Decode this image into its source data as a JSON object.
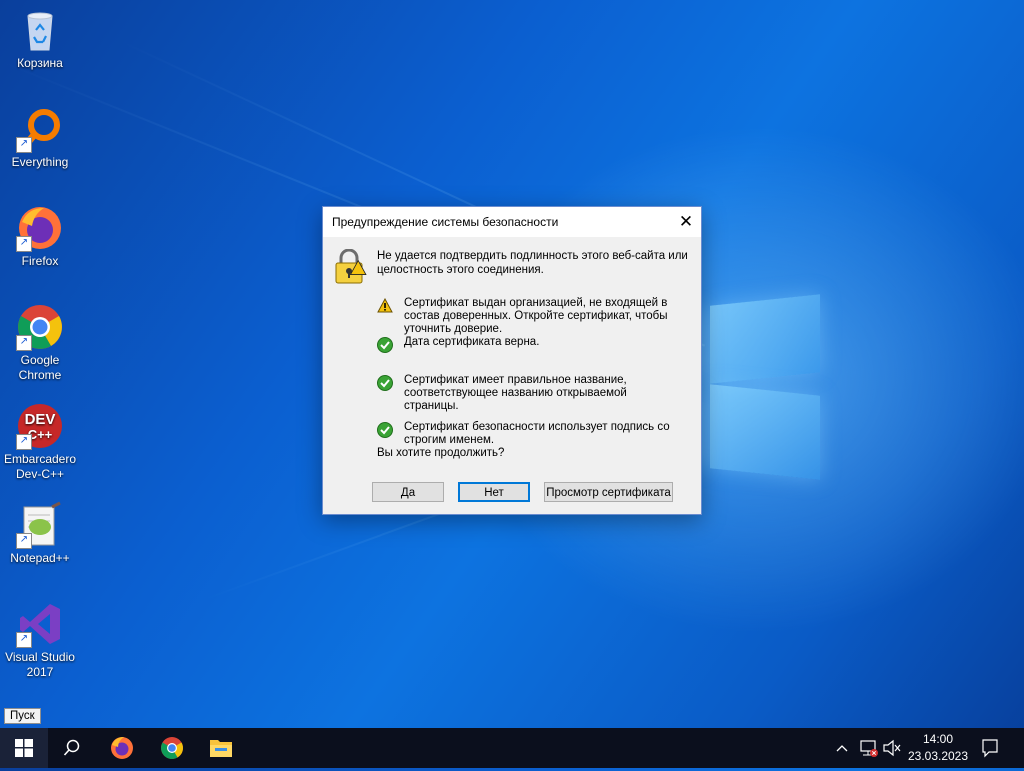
{
  "desktop": {
    "icons": [
      {
        "label": "Корзина",
        "icon": "recycle-bin-icon"
      },
      {
        "label": "Everything",
        "icon": "everything-search-icon"
      },
      {
        "label": "Firefox",
        "icon": "firefox-icon"
      },
      {
        "label": "Google Chrome",
        "icon": "chrome-icon"
      },
      {
        "label": "Embarcadero Dev-C++",
        "icon": "devcpp-icon",
        "glyph_text": "DEV C++"
      },
      {
        "label": "Notepad++",
        "icon": "notepadpp-icon"
      },
      {
        "label": "Visual Studio 2017",
        "icon": "visual-studio-icon"
      }
    ]
  },
  "dialog": {
    "title": "Предупреждение системы безопасности",
    "close_glyph": "✕",
    "intro": "Не удается подтвердить подлинность этого веб-сайта или целостность этого соединения.",
    "checks": [
      {
        "status": "warning",
        "text": "Сертификат выдан организацией, не входящей в состав доверенных. Откройте сертификат, чтобы уточнить доверие."
      },
      {
        "status": "ok",
        "text": "Дата сертификата верна."
      },
      {
        "status": "ok",
        "text": "Сертификат имеет правильное название, соответствующее названию открываемой страницы."
      },
      {
        "status": "ok",
        "text": "Сертификат безопасности использует подпись со строгим именем."
      }
    ],
    "question": "Вы хотите продолжить?",
    "buttons": {
      "yes": "Да",
      "no": "Нет",
      "view_cert": "Просмотр сертификата"
    }
  },
  "taskbar": {
    "start_tooltip": "Пуск",
    "apps": [
      "start-icon",
      "search-icon",
      "firefox-icon",
      "chrome-icon",
      "file-explorer-icon"
    ],
    "tray": {
      "time": "14:00",
      "date": "23.03.2023"
    }
  },
  "colors": {
    "dialog_border": "#6a8ccf",
    "default_button_border": "#0078d7",
    "taskbar": "#0b0f1d",
    "ok_green": "#3aa335",
    "warning_yellow": "#f4c20d"
  }
}
